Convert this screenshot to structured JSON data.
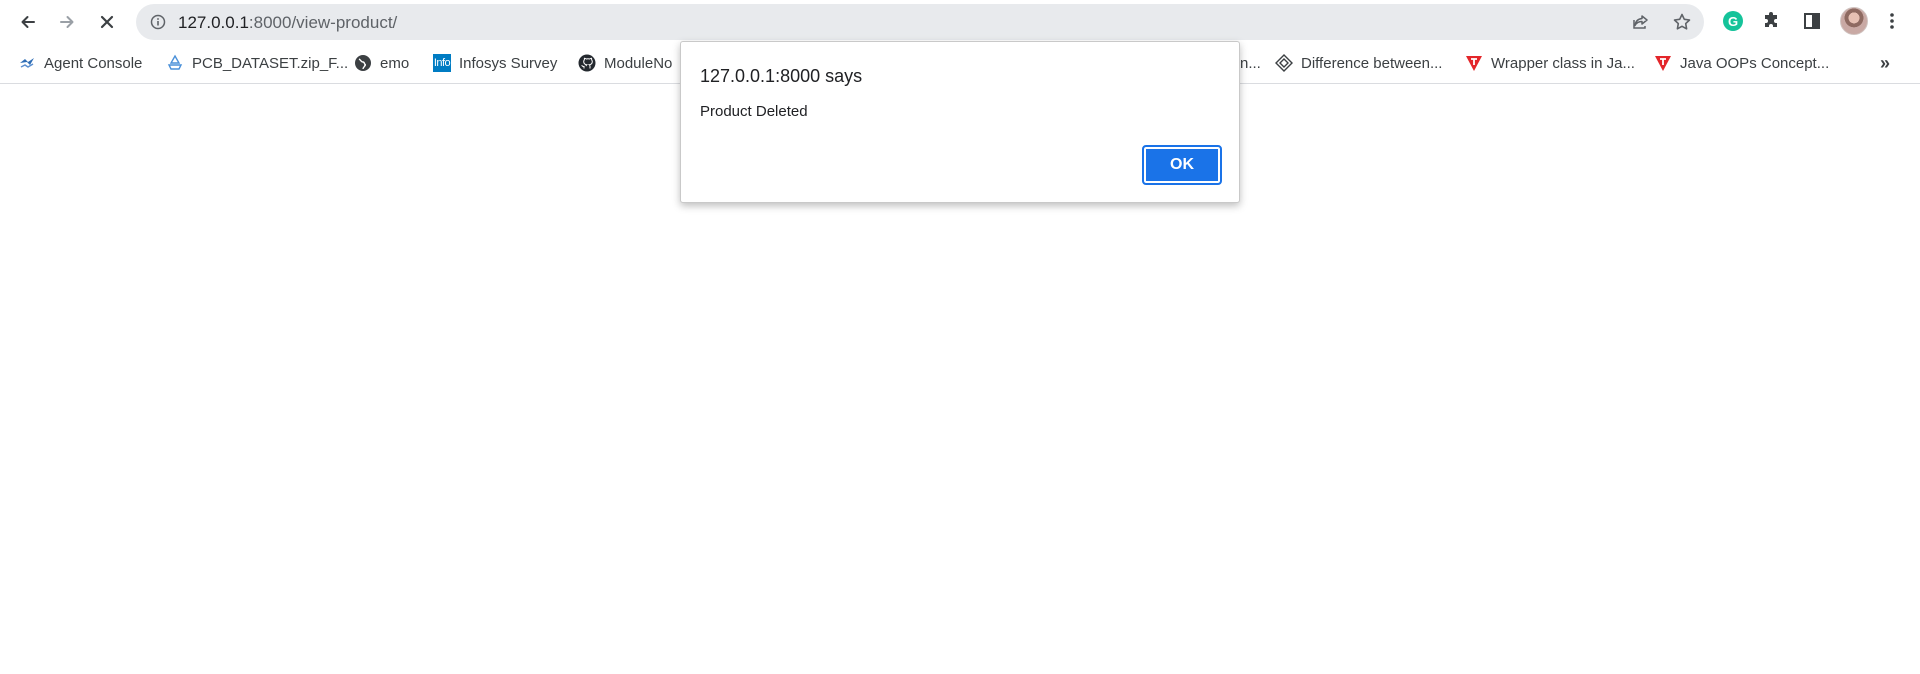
{
  "toolbar": {
    "back_icon": "back-arrow-icon",
    "forward_icon": "forward-arrow-icon",
    "stop_icon": "stop-loading-icon",
    "url_host": "127.0.0.1",
    "url_rest": ":8000/view-product/",
    "info_icon": "info-icon",
    "share_icon": "share-icon",
    "bookmark_icon": "star-icon",
    "grammarly_label": "G",
    "extensions_icon": "puzzle-icon",
    "side_panel_icon": "side-panel-icon",
    "menu_icon": "kebab-menu-icon"
  },
  "bookmarks": [
    {
      "label": "Agent Console",
      "icon": "agent-console-icon"
    },
    {
      "label": "PCB_DATASET.zip_F...",
      "icon": "drive-icon"
    },
    {
      "label": "emo",
      "icon": "globe-icon"
    },
    {
      "label": "Infosys Survey",
      "icon": "infosys-icon",
      "icon_text": "Info"
    },
    {
      "label": "ModuleNo",
      "icon": "github-icon"
    },
    {
      "label": "n...",
      "icon": ""
    },
    {
      "label": "Difference between...",
      "icon": "diamond-icon"
    },
    {
      "label": "Wrapper class in Ja...",
      "icon": "tpoint-icon"
    },
    {
      "label": "Java OOPs Concept...",
      "icon": "tpoint-icon"
    }
  ],
  "bookmarks_overflow": "»",
  "dialog": {
    "title": "127.0.0.1:8000 says",
    "message": "Product Deleted",
    "ok_label": "OK"
  },
  "colors": {
    "accent": "#1a73e8",
    "omnibox_bg": "#e8eaed",
    "tpoint_red": "#e3262a",
    "grammarly_green": "#15c39a"
  }
}
